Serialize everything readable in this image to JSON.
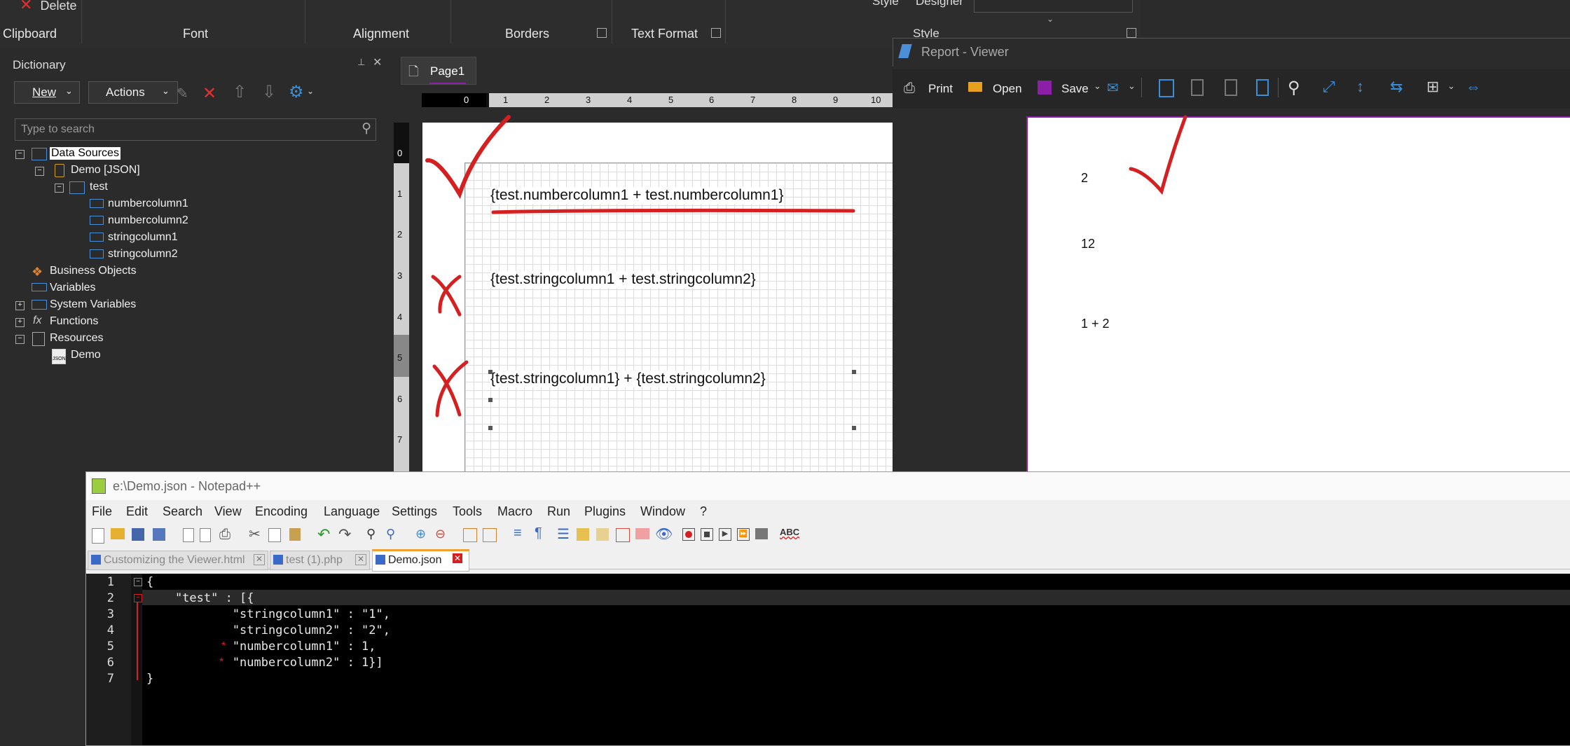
{
  "ribbon": {
    "delete_label": "Delete",
    "style_label": "Style",
    "designer_label": "Designer",
    "style_group_label": "Style",
    "groups": [
      "Clipboard",
      "Font",
      "Alignment",
      "Borders",
      "Text Format"
    ]
  },
  "dictionary": {
    "title": "Dictionary",
    "new_label": "New",
    "actions_label": "Actions",
    "search_placeholder": "Type to search",
    "tree": {
      "data_sources": "Data Sources",
      "demo_json": "Demo [JSON]",
      "test": "test",
      "col1": "numbercolumn1",
      "col2": "numbercolumn2",
      "col3": "stringcolumn1",
      "col4": "stringcolumn2",
      "business_objects": "Business Objects",
      "variables": "Variables",
      "system_variables": "System Variables",
      "functions": "Functions",
      "resources": "Resources",
      "demo": "Demo"
    }
  },
  "designer": {
    "page_tab": "Page1",
    "ruler_top": [
      "0",
      "1",
      "2",
      "3",
      "4",
      "5",
      "6",
      "7",
      "8",
      "9",
      "10"
    ],
    "ruler_left": [
      "0",
      "1",
      "2",
      "3",
      "4",
      "5",
      "6",
      "7"
    ],
    "expr1": "{test.numbercolumn1 + test.numbercolumn1}",
    "expr2": "{test.stringcolumn1 + test.stringcolumn2}",
    "expr3": "{test.stringcolumn1} + {test.stringcolumn2}"
  },
  "viewer": {
    "title": "Report - Viewer",
    "print_label": "Print",
    "open_label": "Open",
    "save_label": "Save",
    "results": [
      "2",
      "12",
      "1 + 2"
    ]
  },
  "notepad": {
    "title": "e:\\Demo.json - Notepad++",
    "menu": [
      "File",
      "Edit",
      "Search",
      "View",
      "Encoding",
      "Language",
      "Settings",
      "Tools",
      "Macro",
      "Run",
      "Plugins",
      "Window",
      "?"
    ],
    "tabs": [
      "Customizing the Viewer.html",
      "test (1).php",
      "Demo.json"
    ],
    "line_numbers": [
      "1",
      "2",
      "3",
      "4",
      "5",
      "6",
      "7"
    ],
    "lines": [
      "{",
      "    \"test\" : [{",
      "            \"stringcolumn1\" : \"1\",",
      "            \"stringcolumn2\" : \"2\",",
      "            \"numbercolumn1\" : 1,",
      "            \"numbercolumn2\" : 1}]",
      "}"
    ]
  },
  "colors": {
    "annotation_red": "#d42020",
    "accent_purple": "#8b1fa8",
    "viewer_toolbar_blue": "#3a8fd8"
  }
}
